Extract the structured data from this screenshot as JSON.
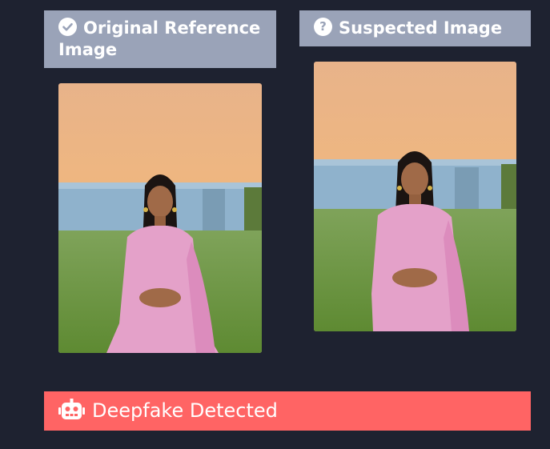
{
  "reference_panel": {
    "title": "Original Reference Image",
    "icon": "check-circle-icon"
  },
  "suspected_panel": {
    "title": "Suspected Image",
    "icon": "question-circle-icon"
  },
  "result": {
    "label": "Deepfake Detected",
    "icon": "robot-icon",
    "color": "#ff6464"
  },
  "colors": {
    "background": "#1e2230",
    "header": "#9aa3b8"
  }
}
